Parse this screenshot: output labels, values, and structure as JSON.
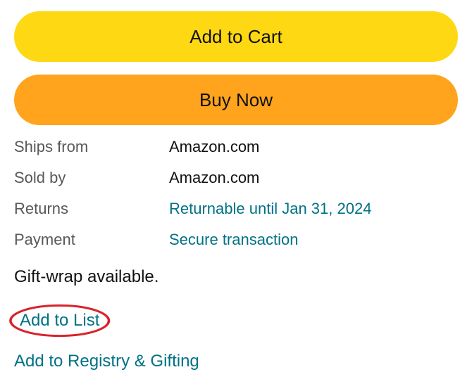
{
  "buttons": {
    "add_to_cart": "Add to Cart",
    "buy_now": "Buy Now"
  },
  "info": {
    "ships_from_label": "Ships from",
    "ships_from_value": "Amazon.com",
    "sold_by_label": "Sold by",
    "sold_by_value": "Amazon.com",
    "returns_label": "Returns",
    "returns_value": "Returnable until Jan 31, 2024",
    "payment_label": "Payment",
    "payment_value": "Secure transaction"
  },
  "gift_wrap": "Gift-wrap available.",
  "links": {
    "add_to_list": "Add to List",
    "add_to_registry": "Add to Registry & Gifting"
  }
}
